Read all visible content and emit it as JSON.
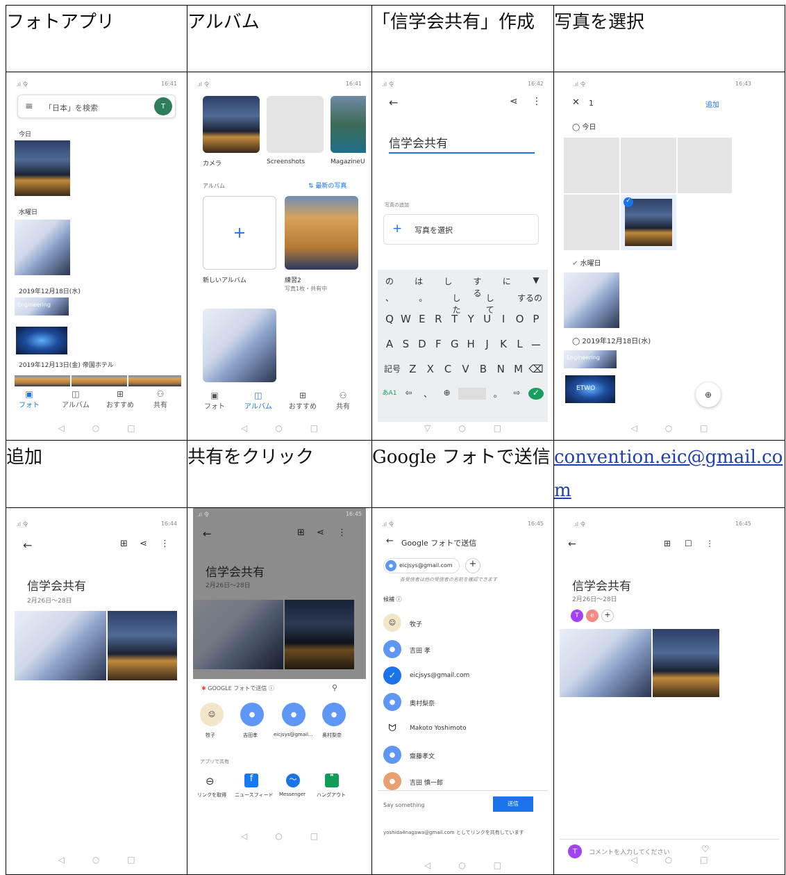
{
  "headers": {
    "r1": [
      "フォトアプリ",
      "アルバム",
      "「信学会共有」作成",
      "写真を選択"
    ],
    "r2": [
      "追加",
      "共有をクリック",
      "Google フォトで送信",
      "convention.eic@gmail.com"
    ]
  },
  "s1": {
    "status_time": "16:41",
    "search_placeholder": "「日本」を検索",
    "avatar": "T",
    "sections": [
      "今日",
      "水曜日",
      "2019年12月18日(水)",
      "2019年12月13日(金)"
    ],
    "hotel_label": "帝国ホテル",
    "engineering_label": "Engineering",
    "tabs": [
      "フォト",
      "アルバム",
      "おすすめ",
      "共有"
    ]
  },
  "s2": {
    "status_time": "16:41",
    "folders": [
      "カメラ",
      "Screenshots",
      "MagazineU"
    ],
    "albums_label": "アルバム",
    "latest_label": "最新の写真",
    "new_album_label": "新しいアルバム",
    "album_name": "練習2",
    "album_sub": "写真1枚・共有中",
    "tabs": [
      "フォト",
      "アルバム",
      "おすすめ",
      "共有"
    ]
  },
  "s3": {
    "status_time": "16:42",
    "title_value": "信学会共有",
    "add_photo_label": "写真の追加",
    "select_button": "写真を選択",
    "suggest1": [
      "の",
      "は",
      "し",
      "する",
      "に"
    ],
    "suggest2": [
      "、",
      "。",
      "した",
      "して",
      "するの"
    ],
    "row_q": [
      "Q",
      "W",
      "E",
      "R",
      "T",
      "Y",
      "U",
      "I",
      "O",
      "P"
    ],
    "row_a": [
      "A",
      "S",
      "D",
      "F",
      "G",
      "H",
      "J",
      "K",
      "L",
      "ー"
    ],
    "row_z": [
      "記号",
      "Z",
      "X",
      "C",
      "V",
      "B",
      "N",
      "M"
    ],
    "key_lang": "あA1"
  },
  "s4": {
    "status_time": "16:43",
    "count": "1",
    "add_button": "追加",
    "sections": [
      "今日",
      "水曜日",
      "2019年12月18日(水)"
    ],
    "engineering_label": "Engineering",
    "etwo_label": "ETWO"
  },
  "s5": {
    "status_time": "16:44",
    "album_title": "信学会共有",
    "date_range": "2月26日〜28日"
  },
  "s6": {
    "status_time": "16:45",
    "album_title": "信学会共有",
    "date_range": "2月26日〜28日",
    "share_header": "GOOGLE フォトで送信",
    "contacts": [
      "牧子",
      "吉田孝",
      "eicjsys@gmail...",
      "奥村梨奈"
    ],
    "apps_label": "アプリで共有",
    "apps": [
      "リンクを取得",
      "ニュースフィード",
      "Messenger",
      "ハングアウト"
    ]
  },
  "s7": {
    "status_time": "16:45",
    "title": "Google フォトで送信",
    "chip_email": "eicjsys@gmail.com",
    "notice": "各受信者は他の受信者の名前を確認できます",
    "candidates_label": "候補",
    "contacts": [
      "牧子",
      "吉田 孝",
      "eicjsys@gmail.com",
      "奥村梨奈",
      "Makoto Yoshimoto",
      "齋藤孝文",
      "吉田 慎一郎"
    ],
    "message_placeholder": "Say something",
    "send_button": "送信",
    "footer_note": "yoshida4nagawa@gmail.com としてリンクを共有しています"
  },
  "s8": {
    "status_time": "16:45",
    "album_title": "信学会共有",
    "date_range": "2月26日〜28日",
    "members": [
      "T",
      "e"
    ],
    "comment_placeholder": "コメントを入力してください",
    "comment_avatar": "T"
  },
  "colors": {
    "accent": "#1a73e8",
    "link": "#1f3fb5",
    "member_t": "#a142f4",
    "member_e": "#f28b82"
  }
}
